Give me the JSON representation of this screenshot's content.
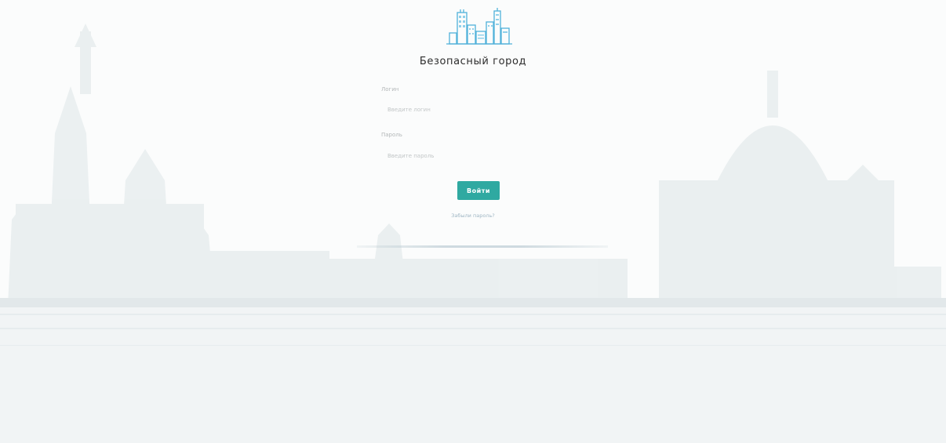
{
  "brand": {
    "logo_icon": "city-buildings-icon",
    "title": "Безопасный город",
    "accent_color": "#2fa9a1"
  },
  "form": {
    "login_label": "Логин",
    "login_placeholder": "Введите логин",
    "password_label": "Пароль",
    "password_placeholder": "Введите пароль",
    "submit_label": "Войти",
    "forgot_label": "Забыли пароль?"
  },
  "background": {
    "icon": "moscow-skyline-illustration"
  }
}
